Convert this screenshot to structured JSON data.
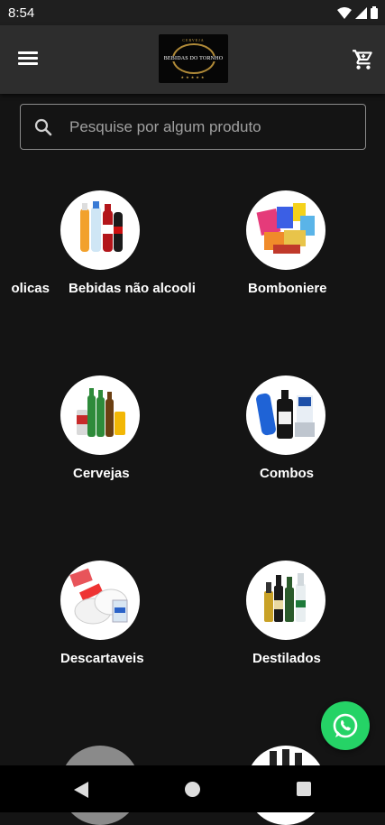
{
  "status_bar": {
    "time": "8:54"
  },
  "header": {
    "logo": {
      "top": "CERVEJA",
      "name": "BEBIDAS DO TORNHO",
      "bottom": "★★★★★"
    }
  },
  "search": {
    "placeholder": "Pesquise por algum produto"
  },
  "categories": [
    {
      "label": "olicas"
    },
    {
      "label": "Bebidas não alcooli"
    },
    {
      "label": "Bomboniere"
    },
    {
      "label": "Cervejas"
    },
    {
      "label": "Combos"
    },
    {
      "label": "Descartaveis"
    },
    {
      "label": "Destilados"
    }
  ],
  "icons": {
    "menu": "menu-icon",
    "cart": "cart-icon",
    "search": "search-icon",
    "whatsapp": "whatsapp-icon",
    "back": "back-icon",
    "home": "home-icon",
    "recent": "recent-apps-icon"
  },
  "colors": {
    "background": "#141414",
    "app_bar": "#2d2d2d",
    "whatsapp": "#25d366",
    "logo_gold": "#b08a38"
  }
}
